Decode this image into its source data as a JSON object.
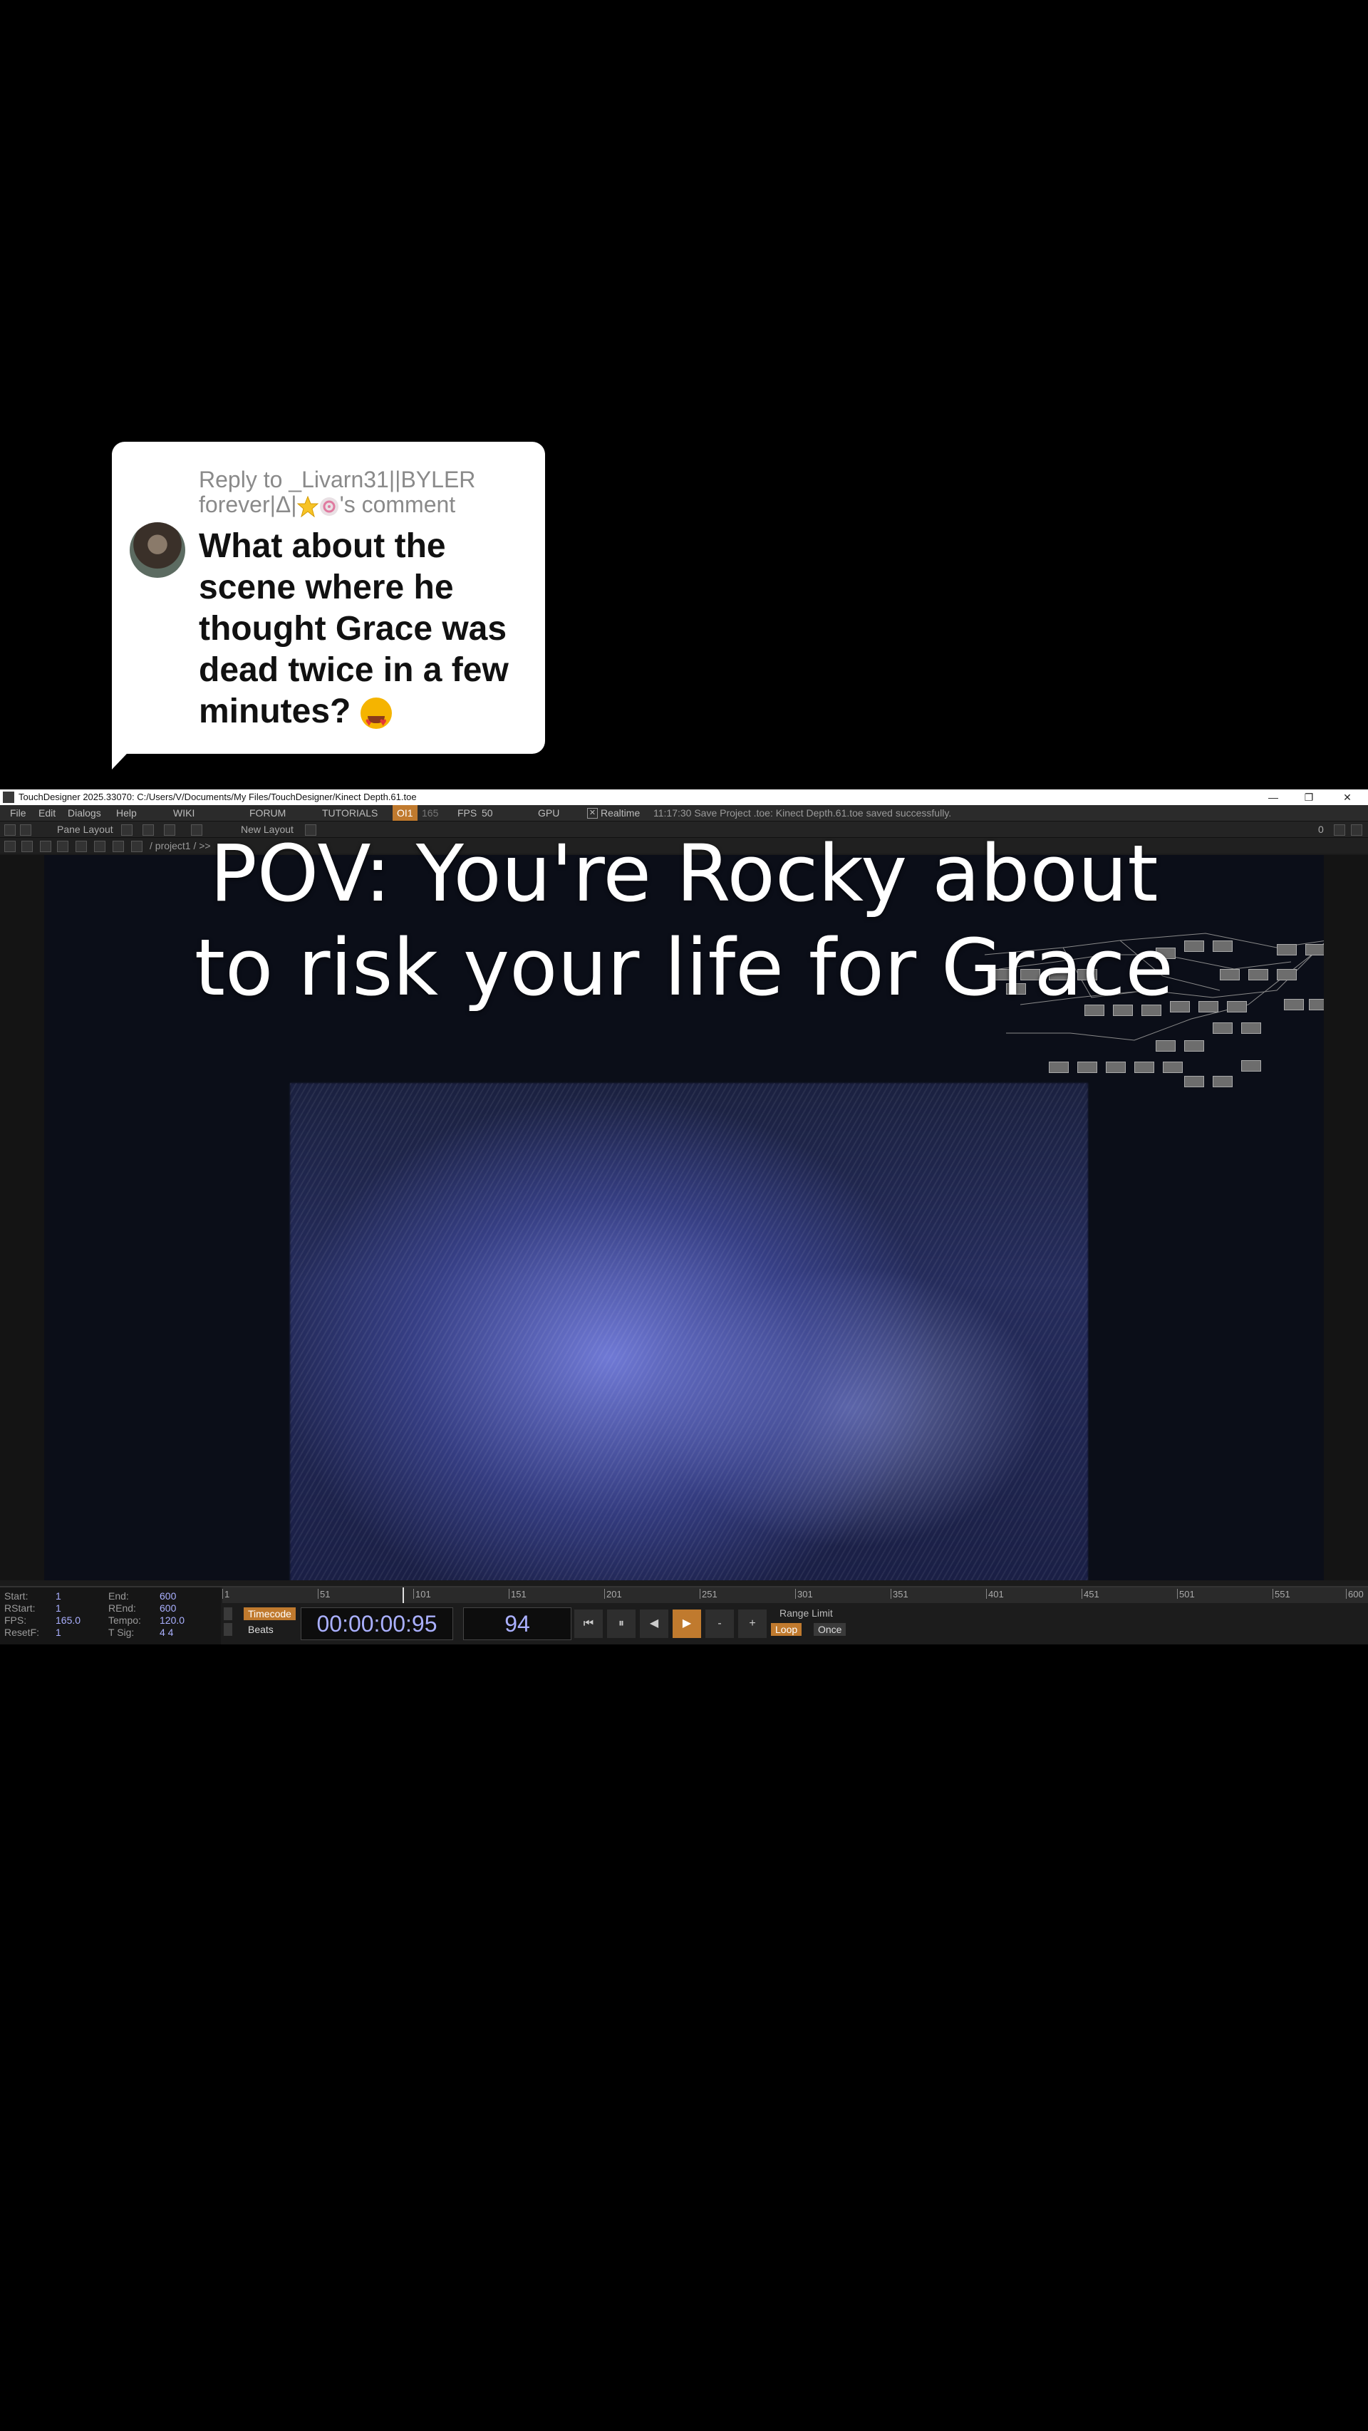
{
  "reply": {
    "header_line1": "Reply to _Livarn31||BYLER",
    "header_line2_a": "forever|Δ|",
    "header_line2_b": "'s comment",
    "body": "What about the scene where he thought Grace was dead twice in a few minutes?"
  },
  "window": {
    "title": "TouchDesigner 2025.33070: C:/Users/V/Documents/My Files/TouchDesigner/Kinect Depth.61.toe",
    "controls": {
      "minimize": "—",
      "restore": "❐",
      "close": "✕"
    }
  },
  "menu": {
    "items": [
      "File",
      "Edit",
      "Dialogs",
      "Help"
    ],
    "links": [
      "WIKI",
      "FORUM",
      "TUTORIALS"
    ],
    "perf_badge": "OI1",
    "perf_value": "165",
    "fps_label": "FPS",
    "fps_value": "50",
    "gpu": "GPU",
    "realtime": "Realtime",
    "status": "11:17:30 Save Project .toe: Kinect Depth.61.toe saved successfully."
  },
  "toolbar": {
    "pane_layout": "Pane Layout",
    "new_layout": "New Layout",
    "right_value": "0"
  },
  "path": {
    "text": "/ project1 / >>"
  },
  "caption": {
    "line1": "POV: You're Rocky about",
    "line2": "to risk your life for Grace"
  },
  "info": {
    "start_k": "Start:",
    "start_v": "1",
    "end_k": "End:",
    "end_v": "600",
    "rstart_k": "RStart:",
    "rstart_v": "1",
    "rend_k": "REnd:",
    "rend_v": "600",
    "fps_k": "FPS:",
    "fps_v": "165.0",
    "tempo_k": "Tempo:",
    "tempo_v": "120.0",
    "resetf_k": "ResetF:",
    "resetf_v": "1",
    "tsig_k": "T Sig:",
    "tsig_v": "4    4"
  },
  "ruler": {
    "ticks": [
      "1",
      "51",
      "101",
      "151",
      "201",
      "251",
      "301",
      "351",
      "401",
      "451",
      "501",
      "551",
      "600"
    ]
  },
  "transport": {
    "timecode_label": "Timecode",
    "beats_label": "Beats",
    "timecode": "00:00:00:95",
    "frame": "94",
    "btn_start": "⏮",
    "btn_pause": "⏸",
    "btn_back": "◀",
    "btn_play": "▶",
    "btn_minus": "-",
    "btn_plus": "+",
    "range_limit": "Range Limit",
    "loop": "Loop",
    "once": "Once"
  },
  "colors": {
    "accent": "#c07a2e",
    "value_text": "#aab0ff"
  }
}
